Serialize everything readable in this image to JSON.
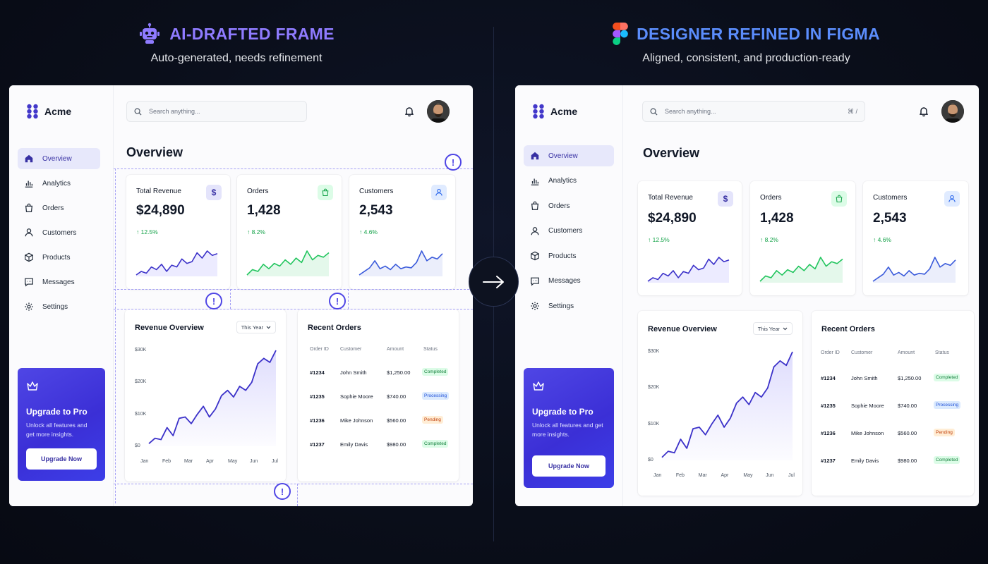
{
  "left_header": {
    "title": "AI-DRAFTED FRAME",
    "subtitle": "Auto-generated, needs refinement"
  },
  "right_header": {
    "title": "DESIGNER REFINED IN FIGMA",
    "subtitle": "Aligned, consistent, and production-ready"
  },
  "colors": {
    "accent": "#4f46e5",
    "left_title": "#8f7bff",
    "right_title": "#5b8dfc",
    "positive": "#16a34a",
    "orders_line": "#22c55e",
    "revenue_line": "#3b31c9"
  },
  "dashboard": {
    "brand": "Acme",
    "search_placeholder": "Search anything...",
    "search_shortcut": "⌘ /",
    "page_title": "Overview",
    "nav": [
      {
        "label": "Overview",
        "icon": "home-icon"
      },
      {
        "label": "Analytics",
        "icon": "bar-chart-icon"
      },
      {
        "label": "Orders",
        "icon": "shopping-bag-icon"
      },
      {
        "label": "Customers",
        "icon": "user-icon"
      },
      {
        "label": "Products",
        "icon": "box-icon"
      },
      {
        "label": "Messages",
        "icon": "message-icon"
      },
      {
        "label": "Settings",
        "icon": "gear-icon"
      }
    ],
    "upgrade": {
      "title": "Upgrade to Pro",
      "text": "Unlock all features and get more insights.",
      "button": "Upgrade Now"
    },
    "stats": [
      {
        "label": "Total Revenue",
        "value": "$24,890",
        "delta": "↑ 12.5%",
        "icon": "$"
      },
      {
        "label": "Orders",
        "value": "1,428",
        "delta": "↑ 8.2%",
        "icon": "bag"
      },
      {
        "label": "Customers",
        "value": "2,543",
        "delta": "↑ 4.6%",
        "icon": "user"
      }
    ],
    "revenue_overview": {
      "title": "Revenue Overview",
      "range": "This Year"
    },
    "recent_orders": {
      "title": "Recent Orders",
      "columns": [
        "Order ID",
        "Customer",
        "Amount",
        "Status"
      ],
      "rows": [
        {
          "id": "#1234",
          "customer": "John Smith",
          "amount": "$1,250.00",
          "status": "Completed"
        },
        {
          "id": "#1235",
          "customer": "Sophie Moore",
          "amount": "$740.00",
          "status": "Processing"
        },
        {
          "id": "#1236",
          "customer": "Mike Johnson",
          "amount": "$560.00",
          "status": "Pending"
        },
        {
          "id": "#1237",
          "customer": "Emily Davis",
          "amount": "$980.00",
          "status": "Completed"
        }
      ],
      "amounts_right": [
        "$1,250.00",
        "$740.00",
        "$560.00",
        "$980.00"
      ]
    }
  },
  "chart_data": [
    {
      "type": "area",
      "title": "Revenue Overview",
      "categories": [
        "Jan",
        "Feb",
        "Mar",
        "Apr",
        "May",
        "Jun",
        "Jul"
      ],
      "y_ticks": [
        "$0",
        "$10K",
        "$20K",
        "$30K"
      ],
      "ylim": [
        0,
        30000
      ],
      "series": [
        {
          "values": [
            1000,
            3000,
            2500,
            7000,
            4000,
            10500,
            11000,
            8500,
            12000,
            15000,
            11000,
            14000,
            19000,
            21000,
            18500,
            22500,
            21000,
            24000,
            31000,
            33000,
            31500,
            36000
          ]
        }
      ],
      "grid": false
    },
    {
      "type": "line",
      "series": [
        {
          "values": [
            10,
            14,
            12,
            19,
            16,
            22,
            14,
            21,
            19,
            28,
            23,
            25,
            35,
            29,
            37,
            32,
            34
          ]
        }
      ]
    },
    {
      "type": "line",
      "series": [
        {
          "values": [
            10,
            16,
            14,
            22,
            17,
            23,
            20,
            27,
            22,
            29,
            24,
            37,
            27,
            32,
            30,
            35
          ]
        }
      ]
    },
    {
      "type": "line",
      "series": [
        {
          "values": [
            10,
            14,
            18,
            26,
            17,
            20,
            16,
            22,
            17,
            19,
            18,
            24,
            37,
            26,
            30,
            28,
            34
          ]
        }
      ]
    }
  ]
}
